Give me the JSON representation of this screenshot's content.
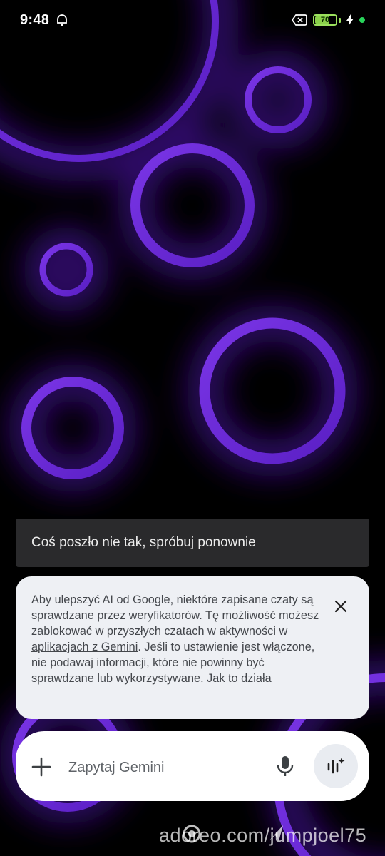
{
  "status_bar": {
    "time": "9:48",
    "battery_level": "70",
    "battery_fraction": 0.7,
    "icons": [
      "alarm-icon",
      "sim-off-icon",
      "battery-icon",
      "charging-bolt-icon",
      "active-dot-icon"
    ]
  },
  "snackbar": {
    "message": "Coś poszło nie tak, spróbuj ponownie"
  },
  "notice": {
    "text_before": "Aby ulepszyć AI od Google, niektóre zapisane czaty są sprawdzane przez weryfikatorów. Tę możliwość możesz zablokować w przyszłych czatach w ",
    "activity_link": "aktywności w aplikacjach z Gemini",
    "text_after": ". Jeśli to ustawienie jest włączone, nie podawaj informacji, które nie powinny być sprawdzane lub wykorzystywane. ",
    "learn_link": "Jak to działa"
  },
  "input_bar": {
    "placeholder": "Zapytaj Gemini",
    "value": ""
  },
  "watermark": "adoreo.com/jumpjoel75",
  "colors": {
    "ring": "#6a2bd8",
    "glow": "#3a0e7a",
    "panel": "#eef0f4",
    "snackbar": "#2a2a2c"
  }
}
